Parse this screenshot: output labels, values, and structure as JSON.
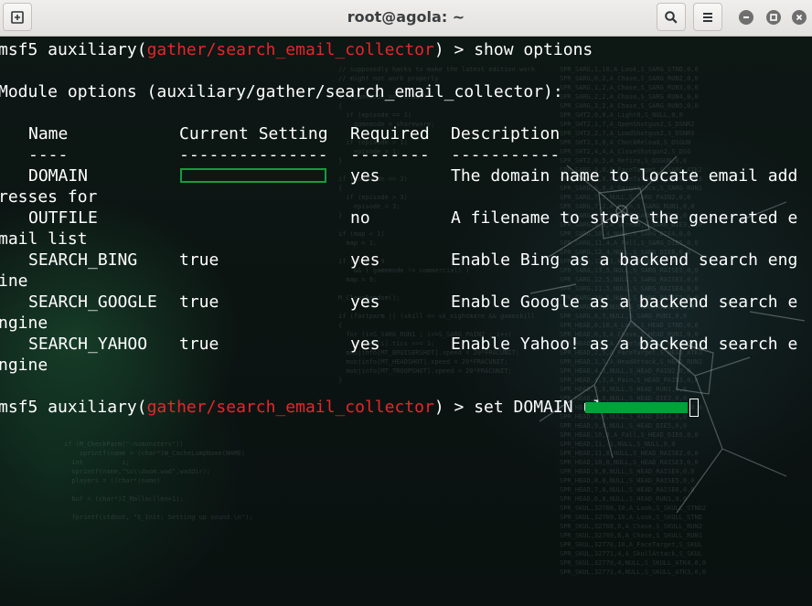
{
  "window": {
    "title": "root@agola: ~",
    "new_tab_icon": "new-tab-icon",
    "search_icon": "search-icon",
    "menu_icon": "hamburger-menu-icon"
  },
  "terminal": {
    "prompt_prefix": "msf5 auxiliary(",
    "module_path": "gather/search_email_collector",
    "prompt_suffix": ") > ",
    "command1": "show options",
    "module_options_header": "Module options (auxiliary/gather/search_email_collector):",
    "columns": {
      "name": "Name",
      "setting": "Current Setting",
      "required": "Required",
      "description": "Description"
    },
    "underlines": {
      "name": "----",
      "setting": "---------------",
      "required": "--------",
      "description": "-----------"
    },
    "rows": [
      {
        "name": "DOMAIN",
        "setting": "",
        "required": "yes",
        "desc1": "The domain name to locate email add",
        "desc2": "resses for"
      },
      {
        "name": "OUTFILE",
        "setting": "",
        "required": "no",
        "desc1": "A filename to store the generated e",
        "desc2": "mail list"
      },
      {
        "name": "SEARCH_BING",
        "setting": "true",
        "required": "yes",
        "desc1": "Enable Bing as a backend search eng",
        "desc2": "ine"
      },
      {
        "name": "SEARCH_GOOGLE",
        "setting": "true",
        "required": "yes",
        "desc1": "Enable Google as a backend search e",
        "desc2": "ngine"
      },
      {
        "name": "SEARCH_YAHOO",
        "setting": "true",
        "required": "yes",
        "desc1": "Enable Yahoo! as a backend search e",
        "desc2": "ngine"
      }
    ],
    "command2": "set DOMAIN ulu"
  },
  "colors": {
    "module_path": "#e8262a",
    "highlight": "#00a23a",
    "terminal_text": "#ffffff"
  }
}
